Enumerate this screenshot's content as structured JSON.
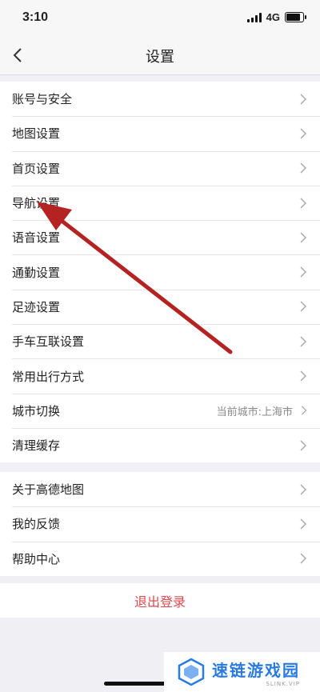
{
  "status_bar": {
    "time": "3:10",
    "network": "4G"
  },
  "nav": {
    "title": "设置"
  },
  "groups": [
    {
      "items": [
        {
          "label": "账号与安全"
        },
        {
          "label": "地图设置"
        },
        {
          "label": "首页设置"
        },
        {
          "label": "导航设置"
        },
        {
          "label": "语音设置"
        },
        {
          "label": "通勤设置"
        },
        {
          "label": "足迹设置"
        },
        {
          "label": "手车互联设置"
        },
        {
          "label": "常用出行方式"
        },
        {
          "label": "城市切换",
          "value": "当前城市:上海市"
        },
        {
          "label": "清理缓存"
        }
      ]
    },
    {
      "items": [
        {
          "label": "关于高德地图"
        },
        {
          "label": "我的反馈"
        },
        {
          "label": "帮助中心"
        }
      ]
    }
  ],
  "logout": {
    "label": "退出登录",
    "color": "#e0474c"
  },
  "annotation": {
    "color": "#b52222"
  },
  "watermark": {
    "main": "速链游戏园",
    "sub": "SLINK.VIP"
  }
}
